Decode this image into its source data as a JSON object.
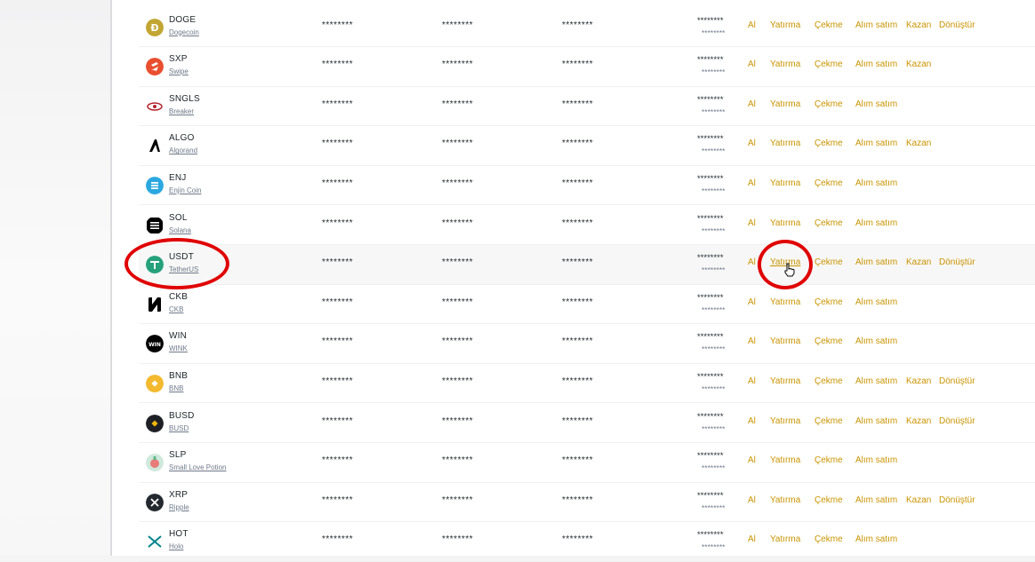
{
  "actions": {
    "al": "Al",
    "yatirma": "Yatırma",
    "cekme": "Çekme",
    "alim_satim": "Alım satım",
    "kazan": "Kazan",
    "donustur": "Dönüştür"
  },
  "masked": "********",
  "rows": [
    {
      "symbol": "DOGE",
      "name": "Dogecoin",
      "icon": "dogecoin-icon",
      "color": "#c2a633",
      "kazan": true,
      "donustur": true
    },
    {
      "symbol": "SXP",
      "name": "Swipe",
      "icon": "swipe-icon",
      "color": "#e94f2f",
      "kazan": true,
      "donustur": false
    },
    {
      "symbol": "SNGLS",
      "name": "Breaker",
      "icon": "breaker-icon",
      "color": "#b3232d",
      "kazan": false,
      "donustur": false
    },
    {
      "symbol": "ALGO",
      "name": "Algorand",
      "icon": "algorand-icon",
      "color": "#000000",
      "kazan": true,
      "donustur": false
    },
    {
      "symbol": "ENJ",
      "name": "Enjin Coin",
      "icon": "enjin-icon",
      "color": "#2ba8e0",
      "kazan": false,
      "donustur": false
    },
    {
      "symbol": "SOL",
      "name": "Solana",
      "icon": "solana-icon",
      "color": "#000000",
      "kazan": false,
      "donustur": false
    },
    {
      "symbol": "USDT",
      "name": "TetherUS",
      "icon": "tether-icon",
      "color": "#26a17b",
      "kazan": true,
      "donustur": true,
      "highlighted": true
    },
    {
      "symbol": "CKB",
      "name": "CKB",
      "icon": "ckb-icon",
      "color": "#000000",
      "kazan": false,
      "donustur": false
    },
    {
      "symbol": "WIN",
      "name": "WINK",
      "icon": "wink-icon",
      "color": "#000000",
      "kazan": false,
      "donustur": false
    },
    {
      "symbol": "BNB",
      "name": "BNB",
      "icon": "bnb-icon",
      "color": "#f3ba2f",
      "kazan": true,
      "donustur": true
    },
    {
      "symbol": "BUSD",
      "name": "BUSD",
      "icon": "busd-icon",
      "color": "#1e2026",
      "kazan": true,
      "donustur": true
    },
    {
      "symbol": "SLP",
      "name": "Small Love Potion",
      "icon": "slp-icon",
      "color": "#5cb88a",
      "kazan": false,
      "donustur": false
    },
    {
      "symbol": "XRP",
      "name": "Ripple",
      "icon": "ripple-icon",
      "color": "#23292f",
      "kazan": true,
      "donustur": true
    },
    {
      "symbol": "HOT",
      "name": "Holo",
      "icon": "holo-icon",
      "color": "#00838d",
      "kazan": false,
      "donustur": false
    }
  ],
  "colors": {
    "action": "#c99400",
    "annotation": "#e00000"
  }
}
